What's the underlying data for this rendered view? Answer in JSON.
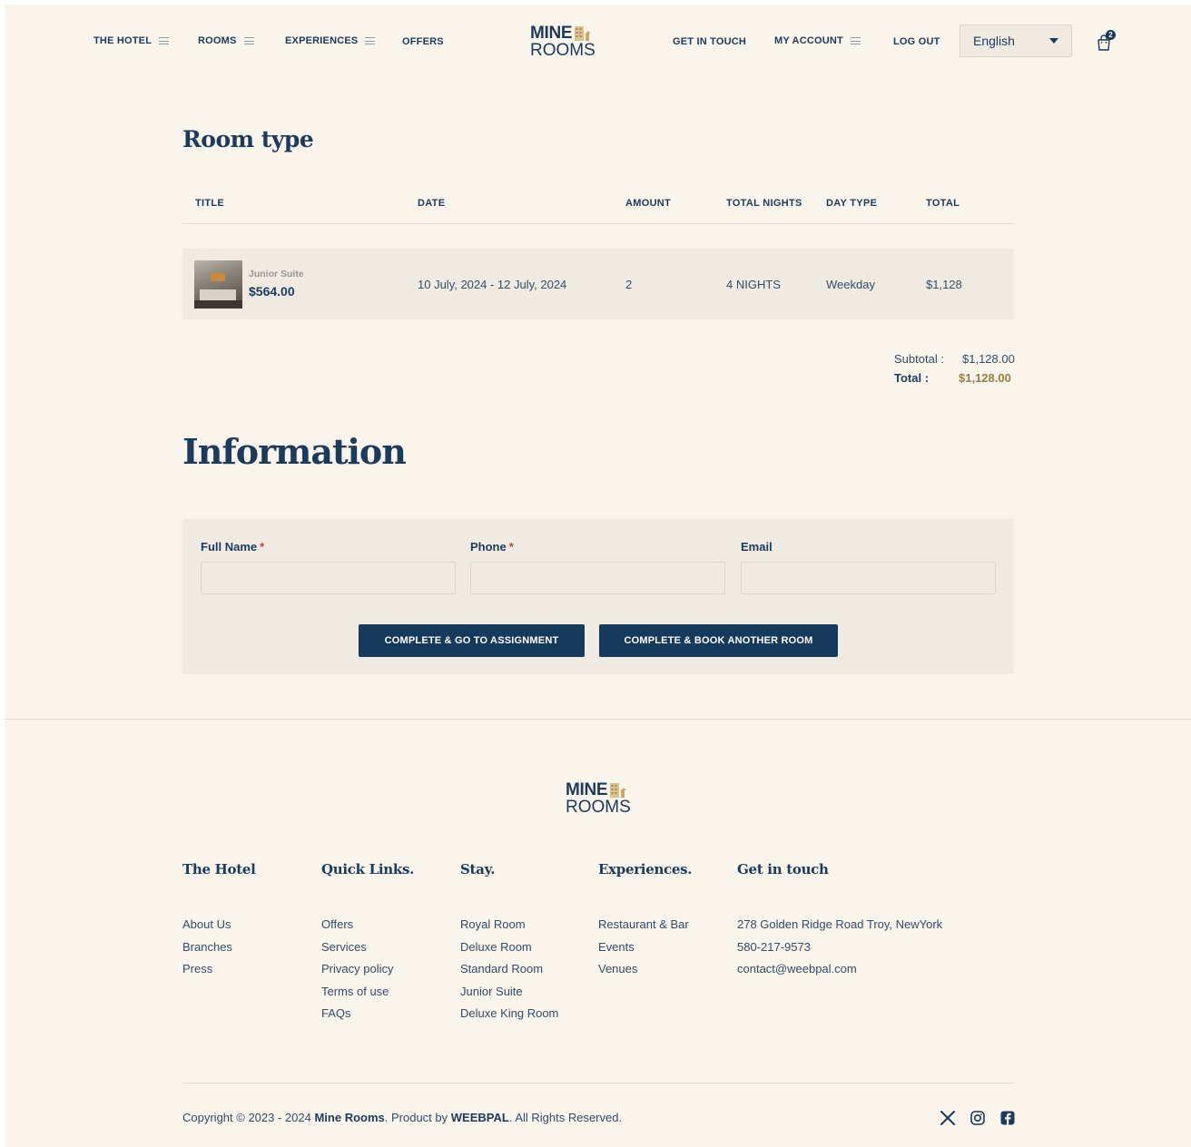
{
  "header": {
    "nav_left": [
      {
        "label": "THE HOTEL",
        "has_menu": true
      },
      {
        "label": "ROOMS",
        "has_menu": true
      },
      {
        "label": "EXPERIENCES",
        "has_menu": true
      },
      {
        "label": "OFFERS",
        "has_menu": false
      }
    ],
    "logo": {
      "line1": "MINE",
      "line2": "ROOMS"
    },
    "nav_right": [
      {
        "label": "GET IN TOUCH",
        "has_menu": false
      },
      {
        "label": "MY ACCOUNT",
        "has_menu": true
      },
      {
        "label": "LOG OUT",
        "has_menu": false
      }
    ],
    "language": "English",
    "cart_count": "2"
  },
  "room_type": {
    "title": "Room type",
    "columns": [
      "TITLE",
      "DATE",
      "AMOUNT",
      "TOTAL NIGHTS",
      "DAY TYPE",
      "TOTAL"
    ],
    "row": {
      "name": "Junior Suite",
      "price": "$564.00",
      "date": "10 July, 2024 - 12 July, 2024",
      "amount": "2",
      "nights": "4 NIGHTS",
      "day_type": "Weekday",
      "total": "$1,128"
    },
    "subtotal_label": "Subtotal :",
    "subtotal_value": "$1,128.00",
    "total_label": "Total :",
    "total_value": "$1,128.00"
  },
  "information": {
    "title": "Information",
    "fields": [
      {
        "label": "Full Name",
        "required": "*",
        "value": ""
      },
      {
        "label": "Phone",
        "required": "*",
        "value": ""
      },
      {
        "label": "Email",
        "required": "",
        "value": ""
      }
    ],
    "buttons": [
      "COMPLETE & GO TO ASSIGNMENT",
      "COMPLETE & BOOK ANOTHER ROOM"
    ]
  },
  "footer": {
    "logo": {
      "line1": "MINE",
      "line2": "ROOMS"
    },
    "columns": [
      {
        "heading": "The Hotel",
        "links": [
          "About Us",
          "Branches",
          "Press"
        ]
      },
      {
        "heading": "Quick Links.",
        "links": [
          "Offers",
          "Services",
          "Privacy policy",
          "Terms of use",
          "FAQs"
        ]
      },
      {
        "heading": "Stay.",
        "links": [
          "Royal Room",
          "Deluxe Room",
          "Standard Room",
          "Junior Suite",
          "Deluxe King Room"
        ]
      },
      {
        "heading": "Experiences.",
        "links": [
          "Restaurant & Bar",
          "Events",
          "Venues"
        ]
      },
      {
        "heading": "Get in touch",
        "links": [
          "278 Golden Ridge Road Troy, NewYork",
          "580-217-9573",
          "contact@weebpal.com"
        ]
      }
    ],
    "copyright": {
      "prefix": "Copyright © 2023 - 2024",
      "brand": "Mine Rooms",
      "middle": ". Product by",
      "company": "WEEBPAL",
      "suffix": ". All Rights Reserved."
    },
    "social": [
      "x-icon",
      "instagram-icon",
      "facebook-icon"
    ]
  },
  "colors": {
    "navy": "#163a5c",
    "gold": "#9a7c3e",
    "background": "#f9f4ec",
    "panel": "#efebe3"
  }
}
